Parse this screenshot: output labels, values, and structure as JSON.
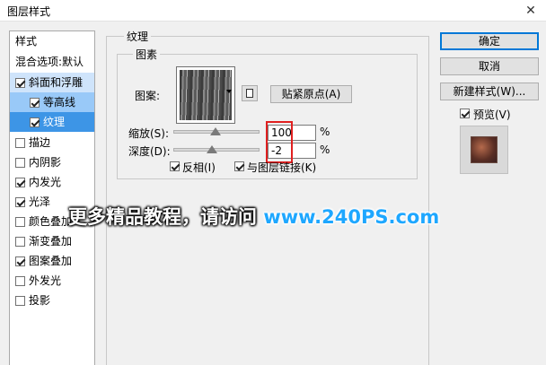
{
  "window": {
    "title": "图层样式",
    "close_glyph": "✕"
  },
  "styles_panel": {
    "header": "样式",
    "blend_options": "混合选项:默认",
    "items": [
      {
        "label": "斜面和浮雕",
        "checked": true
      },
      {
        "label": "等高线",
        "checked": true
      },
      {
        "label": "纹理",
        "checked": true
      },
      {
        "label": "描边",
        "checked": false
      },
      {
        "label": "内阴影",
        "checked": false
      },
      {
        "label": "内发光",
        "checked": true
      },
      {
        "label": "光泽",
        "checked": true
      },
      {
        "label": "颜色叠加",
        "checked": false
      },
      {
        "label": "渐变叠加",
        "checked": false
      },
      {
        "label": "图案叠加",
        "checked": true
      },
      {
        "label": "外发光",
        "checked": false
      },
      {
        "label": "投影",
        "checked": false
      }
    ]
  },
  "texture": {
    "section_title": "纹理",
    "group_title": "图素",
    "pattern_label": "图案:",
    "snap_button": "贴紧原点(A)",
    "scale_label": "缩放(S):",
    "scale_value": "100",
    "scale_unit": "%",
    "depth_label": "深度(D):",
    "depth_value": "-2",
    "depth_unit": "%",
    "invert_label": "反相(I)",
    "invert_checked": true,
    "link_label": "与图层链接(K)",
    "link_checked": true
  },
  "actions": {
    "ok": "确定",
    "cancel": "取消",
    "new_style": "新建样式(W)...",
    "preview_label": "预览(V)",
    "preview_checked": true
  },
  "watermark": {
    "text": "更多精品教程，请访问",
    "url": "www.240PS.com"
  },
  "colors": {
    "selection": "#3d95e6",
    "highlight_box": "#e02020",
    "default_button_border": "#0078d7"
  }
}
